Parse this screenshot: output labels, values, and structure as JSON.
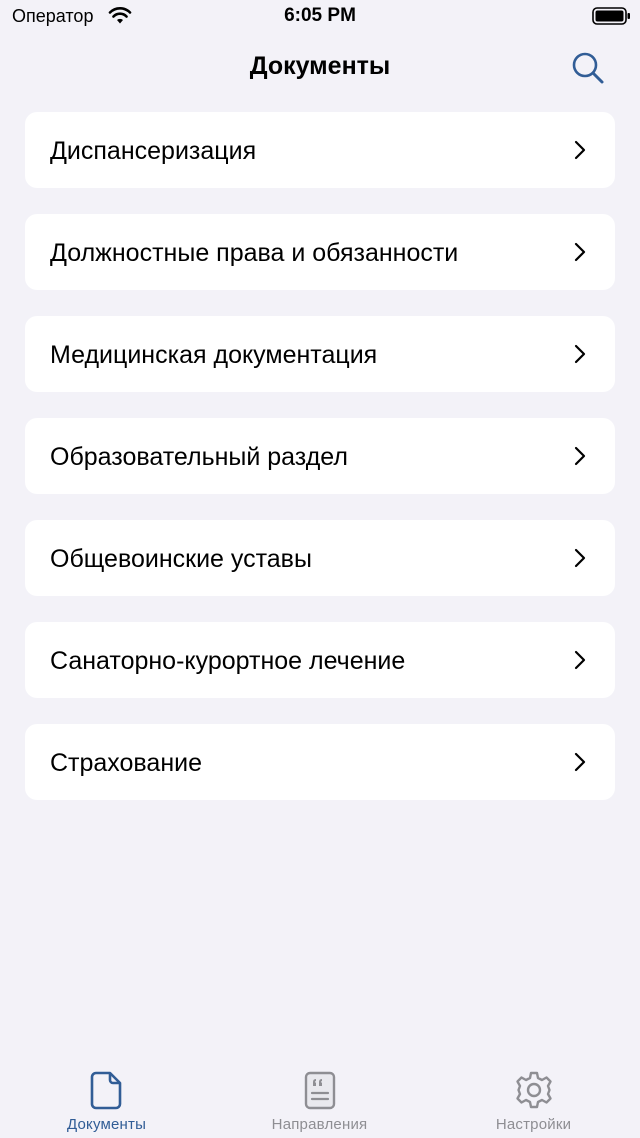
{
  "status_bar": {
    "carrier": "Оператор",
    "time": "6:05 PM"
  },
  "nav": {
    "title": "Документы",
    "search_icon": "search-icon"
  },
  "colors": {
    "background": "#f3f2f8",
    "accent": "#315d96",
    "inactive": "#8e8e93"
  },
  "list": {
    "items": [
      {
        "label": "Диспансеризация"
      },
      {
        "label": "Должностные права и обязанности"
      },
      {
        "label": "Медицинская документация"
      },
      {
        "label": "Образовательный раздел"
      },
      {
        "label": "Общевоинские уставы"
      },
      {
        "label": "Санаторно-курортное лечение"
      },
      {
        "label": "Страхование"
      }
    ]
  },
  "tab_bar": {
    "tabs": [
      {
        "label": "Документы",
        "icon": "document-icon",
        "active": true
      },
      {
        "label": "Направления",
        "icon": "quote-document-icon",
        "active": false
      },
      {
        "label": "Настройки",
        "icon": "gear-icon",
        "active": false
      }
    ]
  }
}
